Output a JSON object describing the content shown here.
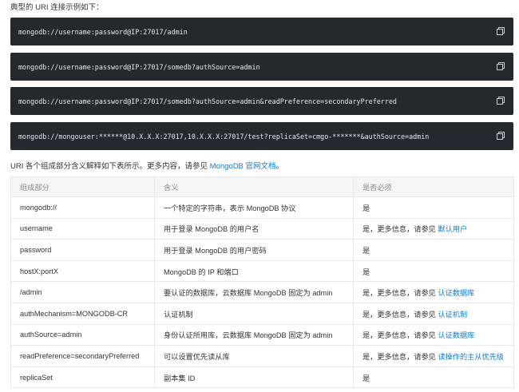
{
  "intro": "典型的 URI 连接示例如下：",
  "code_blocks": [
    "mongodb://username:password@IP:27017/admin",
    "mongodb://username:password@IP:27017/somedb?authSource=admin",
    "mongodb://username:password@IP:27017/somedb?authSource=admin&readPreference=secondaryPreferred",
    "mongodb://mongouser:******@10.X.X.X:27017,10.X.X.X:27017/test?replicaSet=cmgo-*******&authSource=admin"
  ],
  "desc": {
    "text": "URI 各个组成部分含义解释如下表所示。更多内容，请参见 ",
    "link": "MongoDB 官网文档",
    "suffix": "。"
  },
  "table": {
    "headers": [
      "组成部分",
      "含义",
      "是否必须"
    ],
    "rows": [
      {
        "part": "mongodb://",
        "meaning": "一个特定的字符串，表示 MongoDB 协议",
        "req": "是",
        "link": ""
      },
      {
        "part": "username",
        "meaning": "用于登录 MongoDB 的用户名",
        "req": "是，更多信息，请参见 ",
        "link": "默认用户"
      },
      {
        "part": "password",
        "meaning": "用于登录 MongoDB 的用户密码",
        "req": "是",
        "link": ""
      },
      {
        "part": "hostX:portX",
        "meaning": "MongoDB 的 IP 和端口",
        "req": "是",
        "link": ""
      },
      {
        "part": "/admin",
        "meaning": "要认证的数据库，云数据库 MongoDB 固定为 admin",
        "req": "是，更多信息，请参见 ",
        "link": "认证数据库"
      },
      {
        "part": "authMechanism=MONGODB-CR",
        "meaning": "认证机制",
        "req": "是，更多信息，请参见 ",
        "link": "认证机制"
      },
      {
        "part": "authSource=admin",
        "meaning": "身份认证所用库，云数据库 MongoDB 固定为 admin",
        "req": "是，更多信息，请参见 ",
        "link": "认证数据库"
      },
      {
        "part": "readPreference=secondaryPreferred",
        "meaning": "可以设置优先读从库",
        "req": "是，更多信息，请参见 ",
        "link": "读操作的主从优先级"
      },
      {
        "part": "replicaSet",
        "meaning": "副本集 ID",
        "req": "是",
        "link": ""
      }
    ]
  }
}
